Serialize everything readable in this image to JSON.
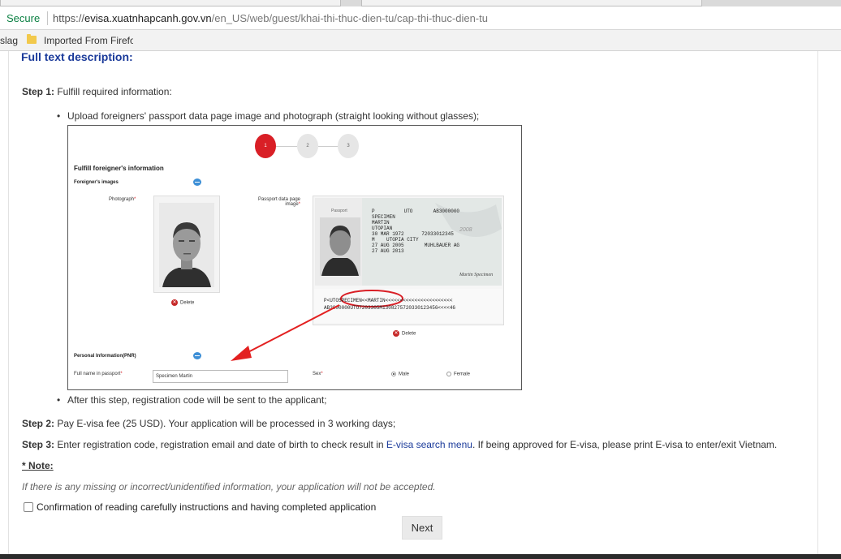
{
  "browser": {
    "secure_label": "Secure",
    "url_proto": "https://",
    "url_host": "evisa.xuatnhapcanh.gov.vn",
    "url_path": "/en_US/web/guest/khai-thi-thuc-dien-tu/cap-thi-thuc-dien-tu",
    "bookmarks": [
      "slag",
      "Imported From Firefo"
    ]
  },
  "content": {
    "title": "Full text description:",
    "step1_label": "Step 1:",
    "step1_text": " Fulfill required information:",
    "bullet1": "Upload foreigners' passport data page image and photograph (straight looking without glasses);",
    "bullet2": "After this step, registration code will be sent to the applicant;",
    "step2_label": "Step 2:",
    "step2_text": " Pay E-visa fee (25 USD). Your application will be processed in 3 working days;",
    "step3_label": "Step 3:",
    "step3_text_a": " Enter registration code, registration email and date of birth to check result in ",
    "step3_link": "E-visa search menu",
    "step3_text_b": ". If being approved for E-visa, please print E-visa to enter/exit Vietnam.",
    "note_title": "* Note:",
    "note_text": "If there is any missing or incorrect/unidentified information, your application will not be accepted.",
    "confirm_label": "Confirmation of reading carefully instructions and having completed application",
    "next_label": "Next"
  },
  "illustration": {
    "steps": [
      "1",
      "2",
      "3"
    ],
    "heading": "Fulfill foreigner's information",
    "images_section": "Foreigner's images",
    "photo_label": "Photograph",
    "passport_label_line1": "Passport data page",
    "passport_label_line2": "image",
    "delete_label": "Delete",
    "pnr_section": "Personal Information(PNR)",
    "fullname_label": "Full name in passport",
    "fullname_value": "Specimen Martin",
    "sex_label": "Sex",
    "male_label": "Male",
    "female_label": "Female",
    "passport_lines": "P          UTO       AB3000000\nSPECIMEN\nMARTIN\nUTOPIAN\n30 MAR 1972      72033012345\nM    UTOPIA CITY\n27 AUG 2005       MUHLBAUER AG\n27 AUG 2013",
    "mrz_line1": "P<UTOSPECIMEN<<MARTIN<<<<<<<<<<<<<<<<<<<<<<<",
    "mrz_line2": "AB3000000UTO7203305M1308275720330123456<<<<46",
    "pp_year": "2008",
    "pp_sign": "Martin Specimen",
    "pp_passport_word": "Passport"
  },
  "colors": {
    "accent_red": "#d91f26",
    "link_blue": "#1a3a9a",
    "secure_green": "#0b8043"
  }
}
